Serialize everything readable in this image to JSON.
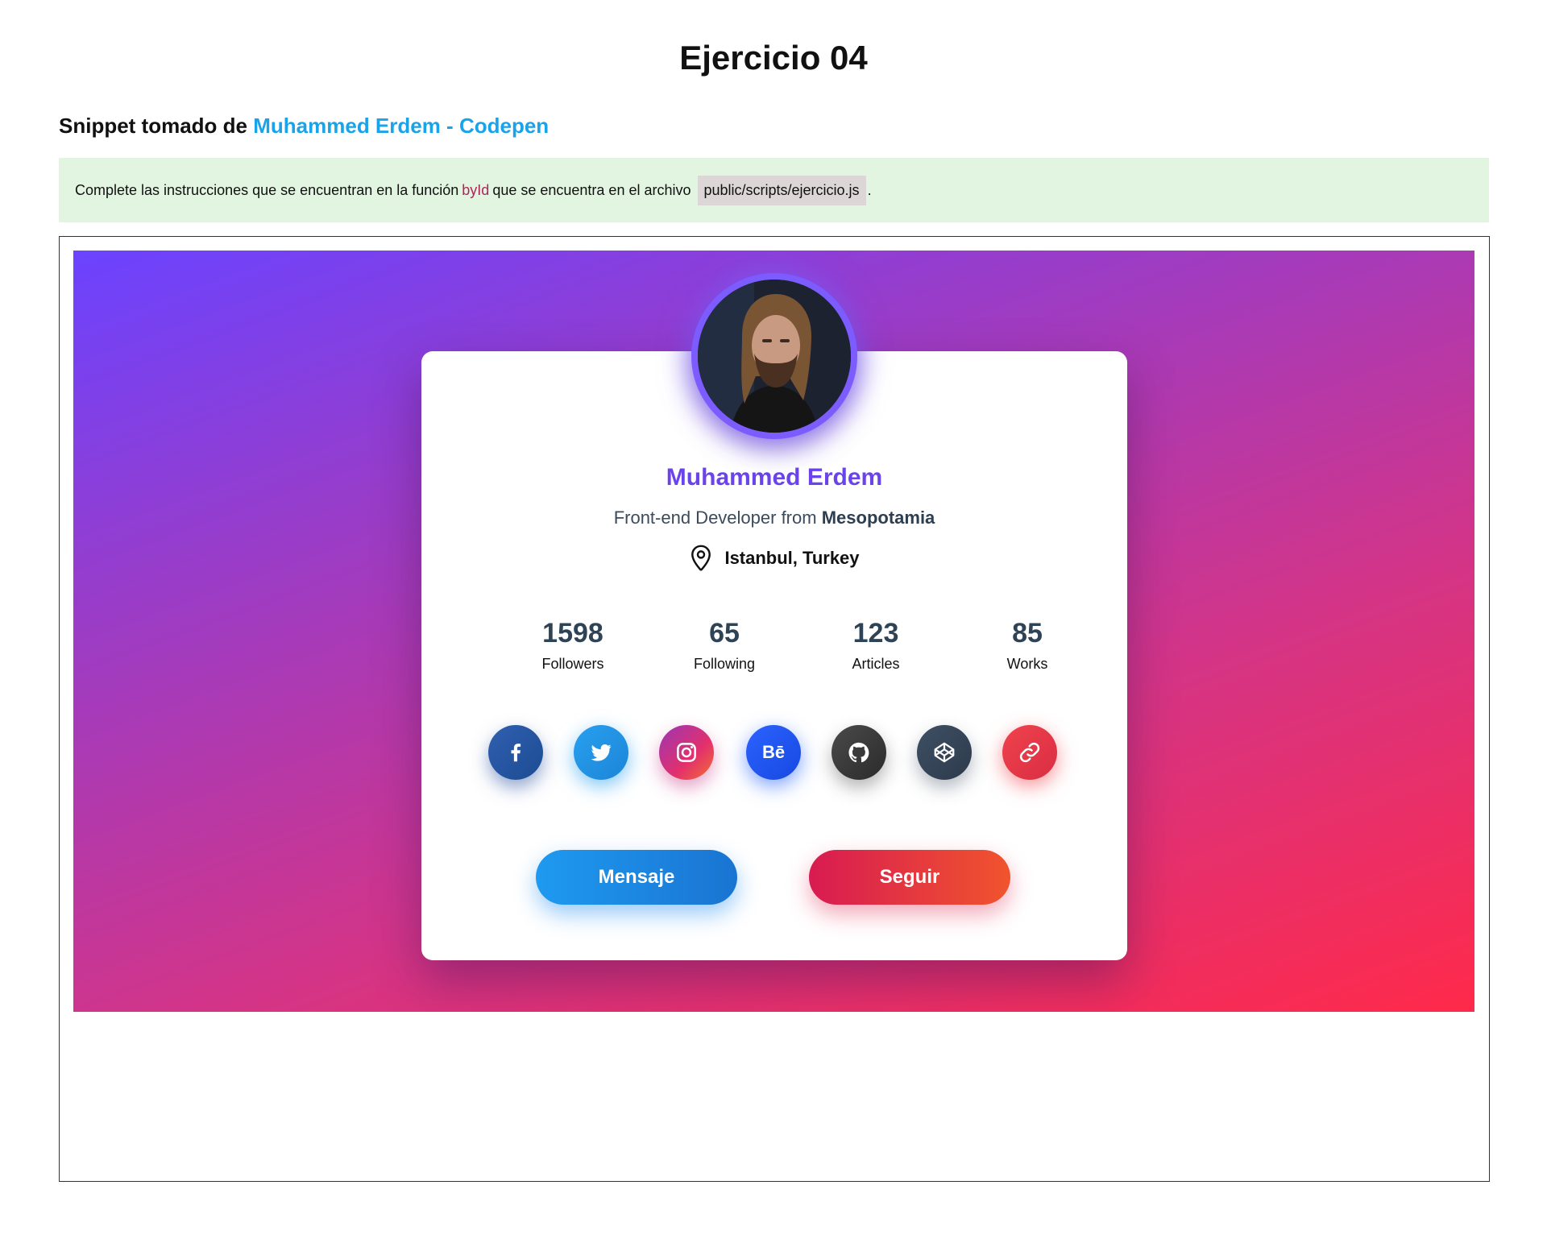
{
  "header": {
    "title": "Ejercicio 04",
    "snippet_prefix": "Snippet tomado de",
    "snippet_link": "Muhammed Erdem - Codepen"
  },
  "notice": {
    "text_before": "Complete las instrucciones que se encuentran en la función",
    "function_name": "byId",
    "text_middle": "que se encuentra en el archivo",
    "file_path": "public/scripts/ejercicio.js",
    "text_end": "."
  },
  "profile": {
    "name": "Muhammed Erdem",
    "role_prefix": "Front-end Developer from",
    "role_place": "Mesopotamia",
    "location": "Istanbul, Turkey",
    "avatar_icon": "user-photo",
    "stats": [
      {
        "value": "1598",
        "label": "Followers"
      },
      {
        "value": "65",
        "label": "Following"
      },
      {
        "value": "123",
        "label": "Articles"
      },
      {
        "value": "85",
        "label": "Works"
      }
    ],
    "socials": [
      {
        "name": "facebook-icon",
        "color": "#2f5fb0"
      },
      {
        "name": "twitter-icon",
        "color": "#28a0ef"
      },
      {
        "name": "instagram-icon",
        "color": "#e2306c"
      },
      {
        "name": "behance-icon",
        "color": "#2d62ff",
        "text": "Bē"
      },
      {
        "name": "github-icon",
        "color": "#3a3a3a"
      },
      {
        "name": "codepen-icon",
        "color": "#34455a"
      },
      {
        "name": "link-icon",
        "color": "#e53645"
      }
    ],
    "buttons": {
      "message": "Mensaje",
      "follow": "Seguir"
    }
  },
  "colors": {
    "accent_name": "#6b43ea",
    "link": "#1aa3e8",
    "notice_bg": "#e2f5e1",
    "hero_gradient_start": "#6b43ff",
    "hero_gradient_end": "#ff2a4a"
  }
}
